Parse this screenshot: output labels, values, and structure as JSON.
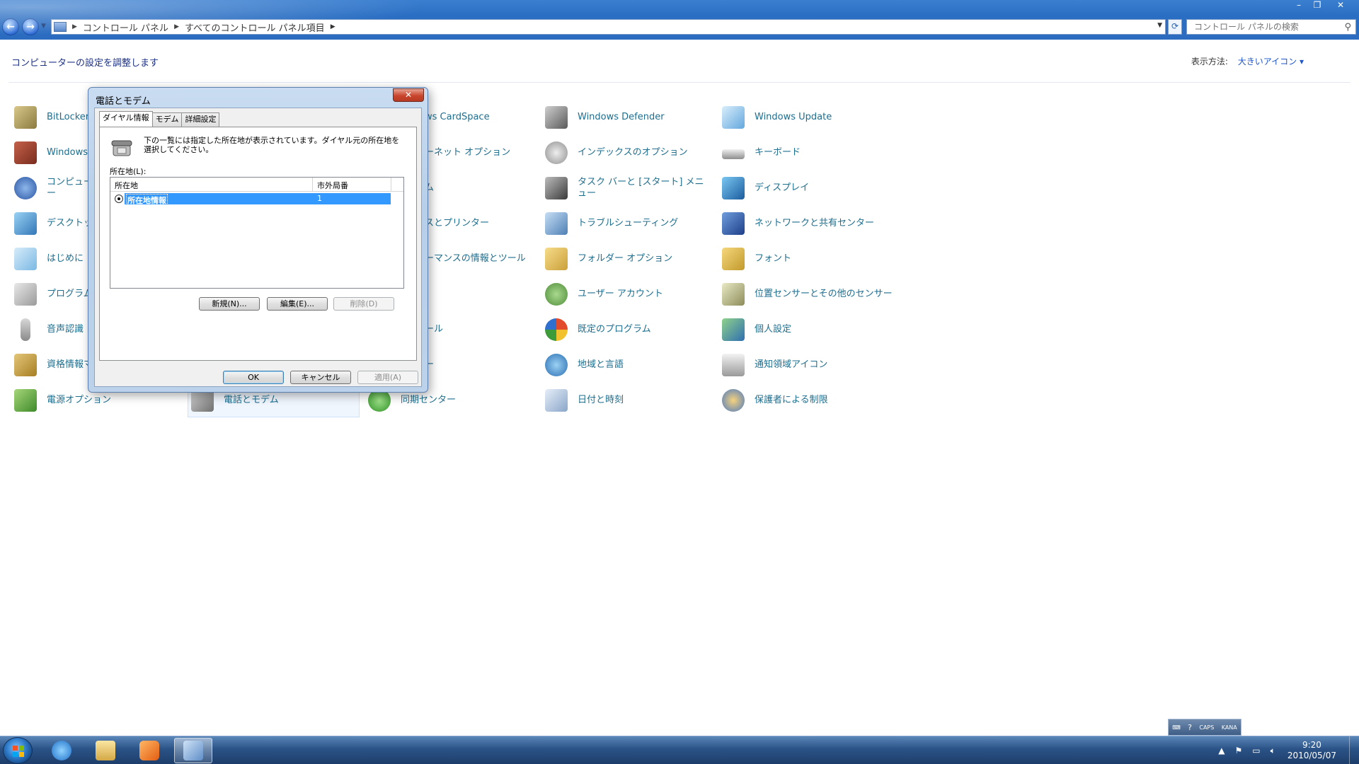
{
  "window": {
    "minimize_glyph": "–",
    "maximize_glyph": "❐",
    "close_glyph": "✕"
  },
  "address": {
    "crumbs": [
      "コントロール パネル",
      "すべてのコントロール パネル項目"
    ],
    "search_placeholder": "コントロール パネルの検索"
  },
  "content": {
    "heading": "コンピューターの設定を調整します",
    "viewby_label": "表示方法:",
    "viewby_value": "大きいアイコン ▾"
  },
  "items": {
    "col1": [
      "BitLocker",
      "Windows フ",
      "コンピュー",
      "デスクトッ",
      "はじめに",
      "プログラム",
      "音声認識",
      "資格情報マ",
      "電源オプション"
    ],
    "col1_b": [
      "ー"
    ],
    "col2": [
      "電話とモデム"
    ],
    "col3": [
      "ws CardSpace",
      "ーネット オプション",
      "ム",
      "スとプリンター",
      "ーマンスの情報とツール",
      "ール",
      "ー",
      "",
      "同期センター"
    ],
    "col4": [
      "Windows Defender",
      "インデックスのオプション",
      "タスク バーと [スタート] メニュー",
      "トラブルシューティング",
      "フォルダー オプション",
      "ユーザー アカウント",
      "既定のプログラム",
      "地域と言語",
      "日付と時刻"
    ],
    "col5": [
      "Windows Update",
      "キーボード",
      "ディスプレイ",
      "ネットワークと共有センター",
      "フォント",
      "位置センサーとその他のセンサー",
      "個人設定",
      "通知領域アイコン",
      "保護者による制限"
    ]
  },
  "dialog": {
    "title": "電話とモデム",
    "close_glyph": "✕",
    "tabs": [
      "ダイヤル情報",
      "モデム",
      "詳細設定"
    ],
    "description": "下の一覧には指定した所在地が表示されています。ダイヤル元の所在地を選択してください。",
    "locations_label": "所在地(L):",
    "columns": [
      "所在地",
      "市外局番"
    ],
    "rows": [
      {
        "name": "所在地情報",
        "code": "1"
      }
    ],
    "btn_new": "新規(N)...",
    "btn_edit": "編集(E)...",
    "btn_delete": "削除(D)",
    "btn_ok": "OK",
    "btn_cancel": "キャンセル",
    "btn_apply": "適用(A)"
  },
  "taskbar": {
    "langbar": [
      "CAPS",
      "KANA"
    ],
    "time": "9:20",
    "date": "2010/05/07"
  },
  "colors": {
    "link": "#1e6e8e",
    "selection": "#3399ff",
    "taskbar": "#2b5387"
  }
}
